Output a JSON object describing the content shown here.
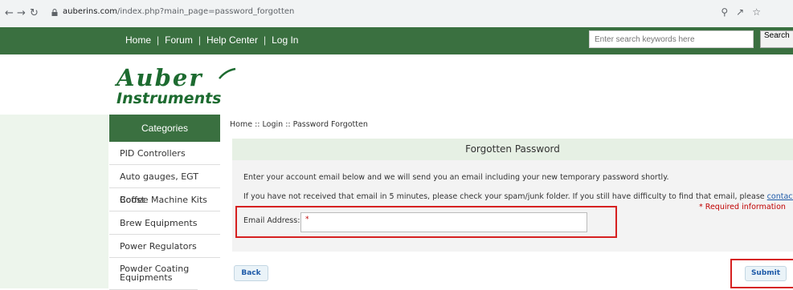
{
  "browser": {
    "url_host": "auberins.com",
    "url_path": "/index.php?main_page=password_forgotten",
    "icons": [
      "zoom-icon",
      "share-icon",
      "star-icon"
    ]
  },
  "header": {
    "nav": [
      "Home",
      "Forum",
      "Help Center",
      "Log In"
    ],
    "separator": "|",
    "search_placeholder": "Enter search keywords here",
    "search_button": "Search"
  },
  "logo": {
    "line1": "Auber",
    "line2": "Instruments"
  },
  "sidebar": {
    "title": "Categories",
    "items": [
      {
        "label": "PID Controllers"
      },
      {
        "label": "Auto gauges, EGT Boost"
      },
      {
        "label": "Coffee Machine Kits"
      },
      {
        "label": "Brew Equipments"
      },
      {
        "label": "Power Regulators"
      },
      {
        "label": "Powder Coating Equipments"
      }
    ]
  },
  "breadcrumb": {
    "home": "Home",
    "login": "Login",
    "current": "Password Forgotten",
    "sep": "::"
  },
  "form": {
    "title": "Forgotten Password",
    "intro": "Enter your account email below and we will send you an email including your new temporary password shortly.",
    "help_text": "If you have not received that email in 5 minutes, please check your spam/junk folder. If you still have difficulty to find that email, please",
    "help_link": "contact us",
    "help_end": ".",
    "required_note": "* Required information",
    "email_label": "Email Address:",
    "email_value": "*",
    "back_button": "Back",
    "submit_button": "Submit"
  },
  "colors": {
    "brand_green": "#3a7040",
    "highlight_red": "#d62020",
    "link_blue": "#1e5aa8"
  }
}
